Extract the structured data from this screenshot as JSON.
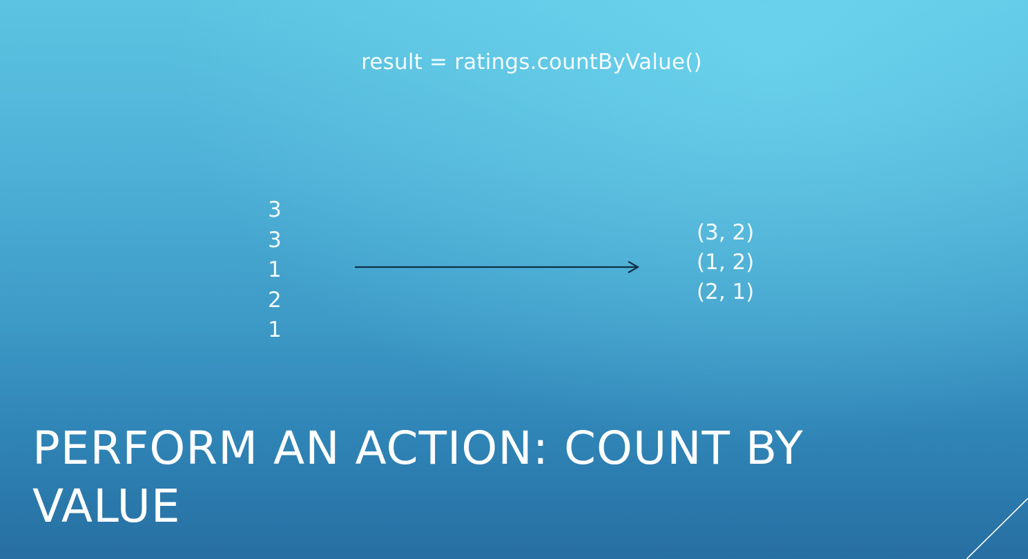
{
  "slide": {
    "code": "result = ratings.countByValue()",
    "input_values": [
      "3",
      "3",
      "1",
      "2",
      "1"
    ],
    "output_pairs": [
      "(3, 2)",
      "(1, 2)",
      "(2, 1)"
    ],
    "title_line1": "PERFORM AN ACTION: COUNT BY",
    "title_line2": "VALUE"
  },
  "colors": {
    "background_top": "#5cc4e2",
    "background_bottom": "#276fa2",
    "text": "#ffffff",
    "arrow": "#0f2f45"
  },
  "icons": {
    "arrow": "right-arrow-icon"
  }
}
